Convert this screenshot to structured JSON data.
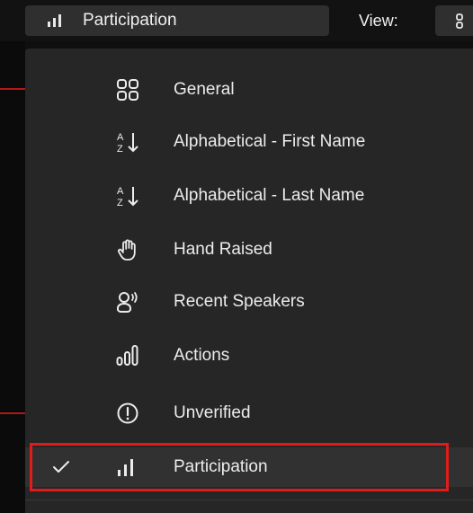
{
  "toolbar": {
    "sort_icon": "bar-chart-icon",
    "sort_label": "Participation",
    "view_label": "View:",
    "view_icon": "grid-icon"
  },
  "menu": {
    "items": [
      {
        "label": "General",
        "icon": "grid-icon",
        "selected": false
      },
      {
        "label": "Alphabetical - First Name",
        "icon": "sort-az-icon",
        "selected": false
      },
      {
        "label": "Alphabetical - Last Name",
        "icon": "sort-az-icon",
        "selected": false
      },
      {
        "label": "Hand Raised",
        "icon": "hand-icon",
        "selected": false
      },
      {
        "label": "Recent Speakers",
        "icon": "speaker-icon",
        "selected": false
      },
      {
        "label": "Actions",
        "icon": "actions-icon",
        "selected": false
      },
      {
        "label": "Unverified",
        "icon": "exclamation-circle-icon",
        "selected": false
      },
      {
        "label": "Participation",
        "icon": "bar-chart-icon",
        "selected": true
      }
    ]
  },
  "colors": {
    "menu_background": "#262626",
    "highlight_border": "#e01b1b",
    "text": "#ececec"
  }
}
